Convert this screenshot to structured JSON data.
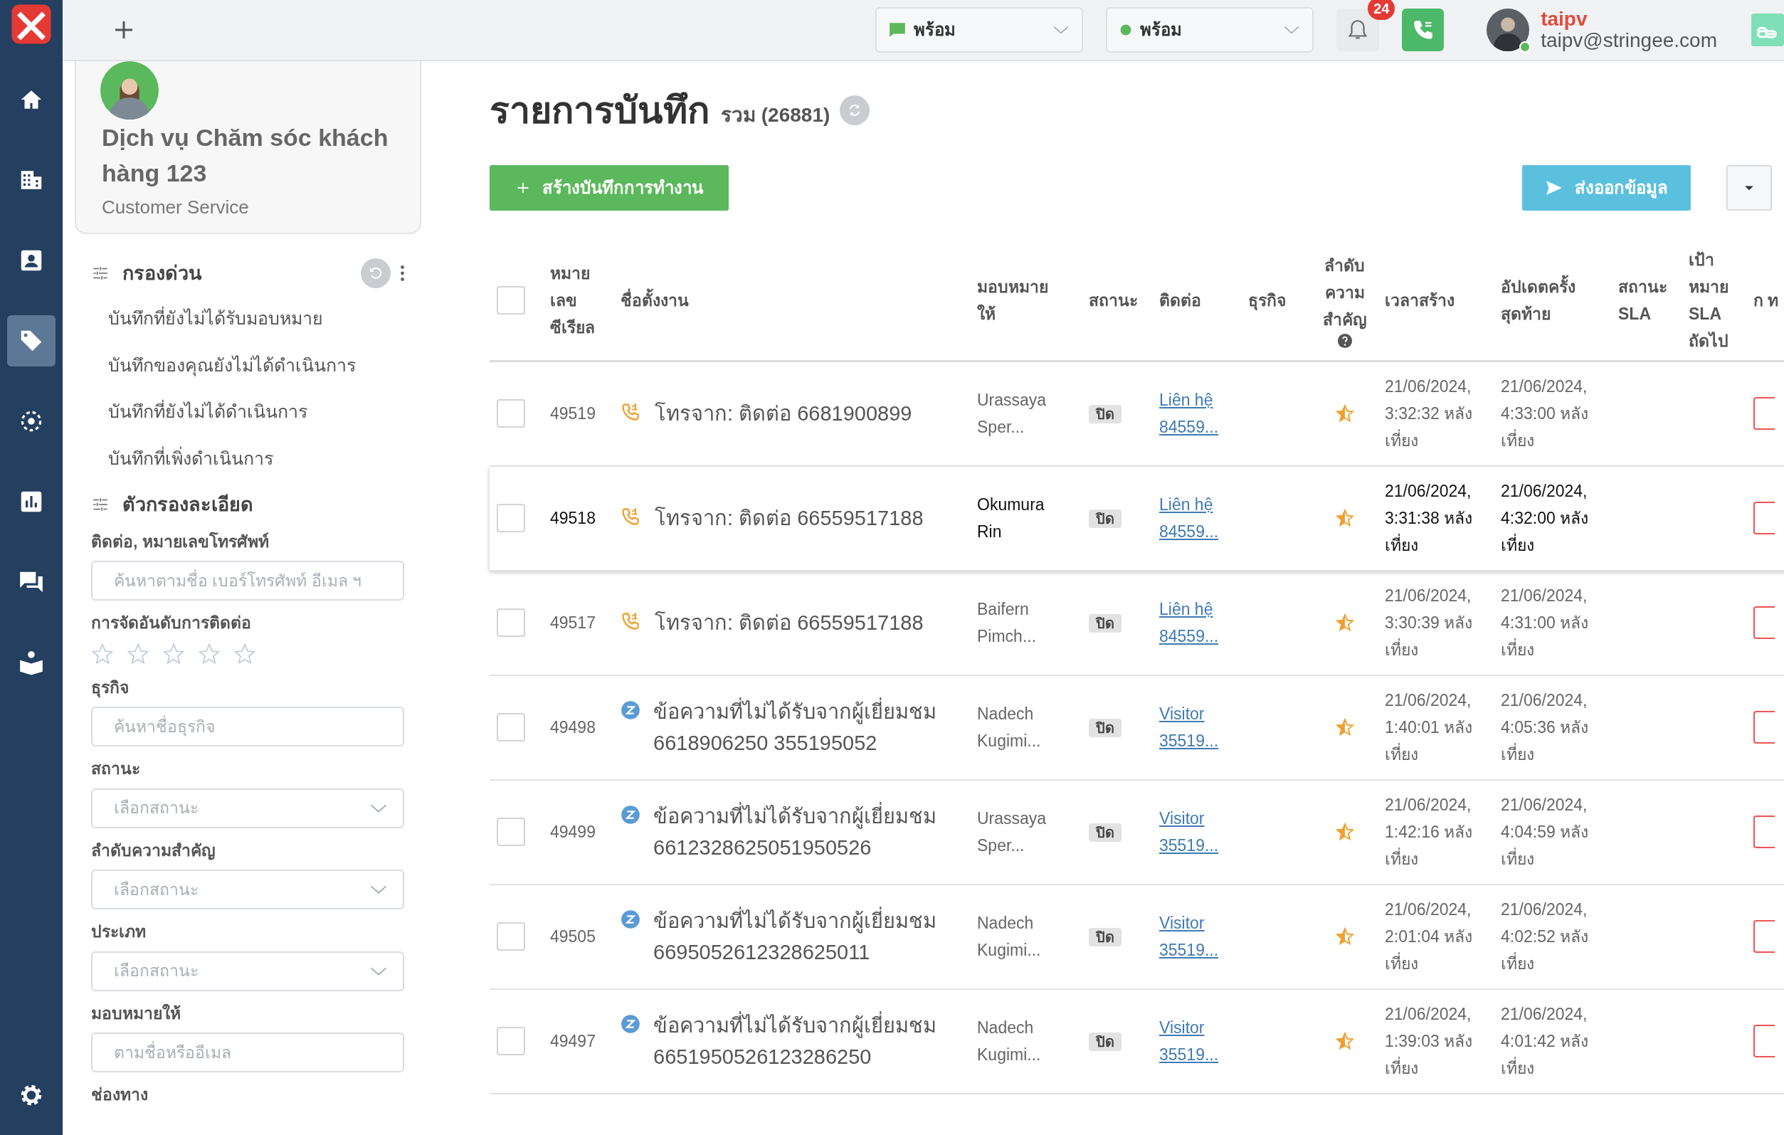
{
  "nav": {
    "items": [
      {
        "selected": false
      },
      {
        "selected": false
      },
      {
        "selected": false
      },
      {
        "selected": true
      },
      {
        "selected": false
      },
      {
        "selected": false
      },
      {
        "selected": false
      },
      {
        "selected": false
      }
    ]
  },
  "topbar": {
    "status_selects": [
      {
        "kind": "chat",
        "label": "พร้อม"
      },
      {
        "kind": "dot",
        "label": "พร้อม"
      }
    ],
    "notification_count": "24",
    "user": {
      "name": "taipv",
      "email": "taipv@stringee.com",
      "online": true
    }
  },
  "profile": {
    "title": "Dịch vụ Chăm sóc khách hàng 123",
    "subtitle": "Customer Service"
  },
  "quick_filter": {
    "title": "กรองด่วน",
    "items": [
      "บันทึกที่ยังไม่ได้รับมอบหมาย",
      "บันทึกของคุณยังไม่ได้ดำเนินการ",
      "บันทึกที่ยังไม่ได้ดำเนินการ",
      "บันทึกที่เพิ่งดำเนินการ"
    ]
  },
  "detail_filter": {
    "title": "ตัวกรองละเอียด",
    "fields": [
      {
        "kind": "text",
        "label": "ติดต่อ, หมายเลขโทรศัพท์",
        "placeholder": "ค้นหาตามชื่อ เบอร์โทรศัพท์ อีเมล ฯ"
      },
      {
        "kind": "stars",
        "label": "การจัดอันดับการติดต่อ",
        "stars": 0
      },
      {
        "kind": "text",
        "label": "ธุรกิจ",
        "placeholder": "ค้นหาชื่อธุรกิจ"
      },
      {
        "kind": "select",
        "label": "สถานะ",
        "placeholder": "เลือกสถานะ"
      },
      {
        "kind": "select",
        "label": "ลำดับความสำคัญ",
        "placeholder": "เลือกสถานะ"
      },
      {
        "kind": "select",
        "label": "ประเภท",
        "placeholder": "เลือกสถานะ"
      },
      {
        "kind": "text",
        "label": "มอบหมายให้",
        "placeholder": "ตามชื่อหรืออีเมล"
      },
      {
        "kind": "label",
        "label": "ช่องทาง"
      }
    ]
  },
  "page": {
    "title": "รายการบันทึก",
    "total": "รวม (26881)",
    "create_button": "สร้างบันทึกการทำงาน",
    "export_button": "ส่งออกข้อมูล"
  },
  "table": {
    "header_checked": false,
    "columns": [
      "หมายเลขซีเรียล",
      "ชื่อตั้งงาน",
      "มอบหมายให้",
      "สถานะ",
      "ติดต่อ",
      "ธุรกิจ",
      "ลำดับความสำคัญ",
      "เวลาสร้าง",
      "อัปเดตครั้งสุดท้าย",
      "สถานะ SLA",
      "เป้าหมาย SLA ถัดไป",
      "ก ท"
    ],
    "rows": [
      {
        "checked": false,
        "unread": false,
        "serial": "49519",
        "kind": "call",
        "title": "โทรจาก: ติดต่อ 6681900899",
        "assignee": "Urassaya Sper...",
        "status": "ปิด",
        "contact": "Liên hệ 84559...",
        "created": "21/06/2024, 3:32:32 หลังเที่ยง",
        "updated": "21/06/2024, 4:33:00 หลังเที่ยง"
      },
      {
        "checked": false,
        "unread": true,
        "serial": "49518",
        "kind": "call",
        "title": "โทรจาก: ติดต่อ 66559517188",
        "assignee": "Okumura Rin",
        "status": "ปิด",
        "contact": "Liên hệ 84559...",
        "created": "21/06/2024, 3:31:38 หลังเที่ยง",
        "updated": "21/06/2024, 4:32:00 หลังเที่ยง"
      },
      {
        "checked": false,
        "unread": false,
        "serial": "49517",
        "kind": "call",
        "title": "โทรจาก: ติดต่อ 66559517188",
        "assignee": "Baifern Pimch...",
        "status": "ปิด",
        "contact": "Liên hệ 84559...",
        "created": "21/06/2024, 3:30:39 หลังเที่ยง",
        "updated": "21/06/2024, 4:31:00 หลังเที่ยง"
      },
      {
        "checked": false,
        "unread": false,
        "serial": "49498",
        "kind": "chat",
        "title": "ข้อความที่ไม่ได้รับจากผู้เยี่ยมชม 6618906250 355195052",
        "assignee": "Nadech Kugimi...",
        "status": "ปิด",
        "contact": "Visitor 35519...",
        "created": "21/06/2024, 1:40:01 หลังเที่ยง",
        "updated": "21/06/2024, 4:05:36 หลังเที่ยง"
      },
      {
        "checked": false,
        "unread": false,
        "serial": "49499",
        "kind": "chat",
        "title": "ข้อความที่ไม่ได้รับจากผู้เยี่ยมชม 6612328625051950526",
        "assignee": "Urassaya Sper...",
        "status": "ปิด",
        "contact": "Visitor 35519...",
        "created": "21/06/2024, 1:42:16 หลังเที่ยง",
        "updated": "21/06/2024, 4:04:59 หลังเที่ยง"
      },
      {
        "checked": false,
        "unread": false,
        "serial": "49505",
        "kind": "chat",
        "title": "ข้อความที่ไม่ได้รับจากผู้เยี่ยมชม 6695052612328625011",
        "assignee": "Nadech Kugimi...",
        "status": "ปิด",
        "contact": "Visitor 35519...",
        "created": "21/06/2024, 2:01:04 หลังเที่ยง",
        "updated": "21/06/2024, 4:02:52 หลังเที่ยง"
      },
      {
        "checked": false,
        "unread": false,
        "serial": "49497",
        "kind": "chat",
        "title": "ข้อความที่ไม่ได้รับจากผู้เยี่ยมชม 6651950526123286250",
        "assignee": "Nadech Kugimi...",
        "status": "ปิด",
        "contact": "Visitor 35519...",
        "created": "21/06/2024, 1:39:03 หลังเที่ยง",
        "updated": "21/06/2024, 4:01:42 หลังเที่ยง"
      }
    ]
  }
}
